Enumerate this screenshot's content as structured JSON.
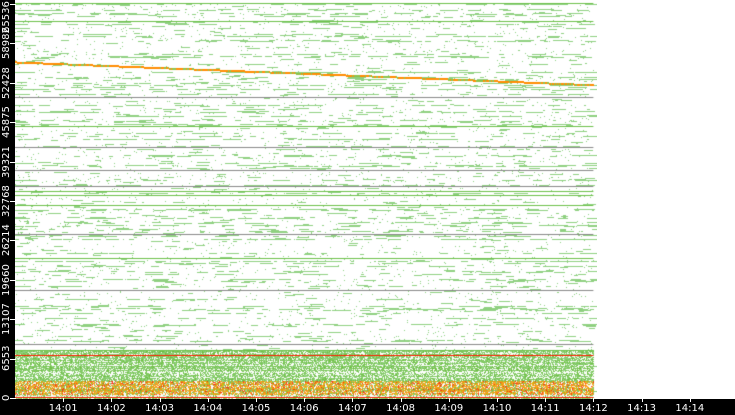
{
  "chart_data": {
    "type": "scatter",
    "title": "",
    "xlabel": "",
    "ylabel": "",
    "y_ticks": [
      "0",
      "6553",
      "13107",
      "19660",
      "26214",
      "32768",
      "39321",
      "45875",
      "52428",
      "58982",
      "65536"
    ],
    "y_tick_values": [
      0,
      6553,
      13107,
      19660,
      26214,
      32768,
      39321,
      45875,
      52428,
      58982,
      65536
    ],
    "ylim": [
      0,
      65536
    ],
    "x_ticks": [
      "14:01",
      "14:02",
      "14:03",
      "14:04",
      "14:05",
      "14:06",
      "14:07",
      "14:08",
      "14:09",
      "14:10",
      "14:11",
      "14:12",
      "14:13",
      "14:14"
    ],
    "x_tick_minutes": [
      1,
      2,
      3,
      4,
      5,
      6,
      7,
      8,
      9,
      10,
      11,
      12,
      13,
      14
    ],
    "xlim_minutes": [
      0.0,
      14.8
    ],
    "data_end_minute": 12.0,
    "sloped_series": {
      "start": [
        0.0,
        55900
      ],
      "end": [
        12.0,
        52100
      ],
      "colors": [
        "#ff8c00",
        "#8bc34a"
      ]
    },
    "gray_lines": [
      49920,
      41600,
      37770,
      35100,
      27120,
      17800,
      8820
    ],
    "green_lines": [
      65540,
      62550,
      45210,
      34270,
      33600,
      31940,
      23130,
      7980
    ],
    "dense_band": {
      "from": 0,
      "to": 7990,
      "hot_from": 500,
      "hot_to": 2800
    },
    "colors": {
      "sparse": "#8fd080",
      "line": "#6cc04a",
      "gray": "#888888",
      "hot": "#ff8c00",
      "hotter": "#ff2000"
    }
  }
}
